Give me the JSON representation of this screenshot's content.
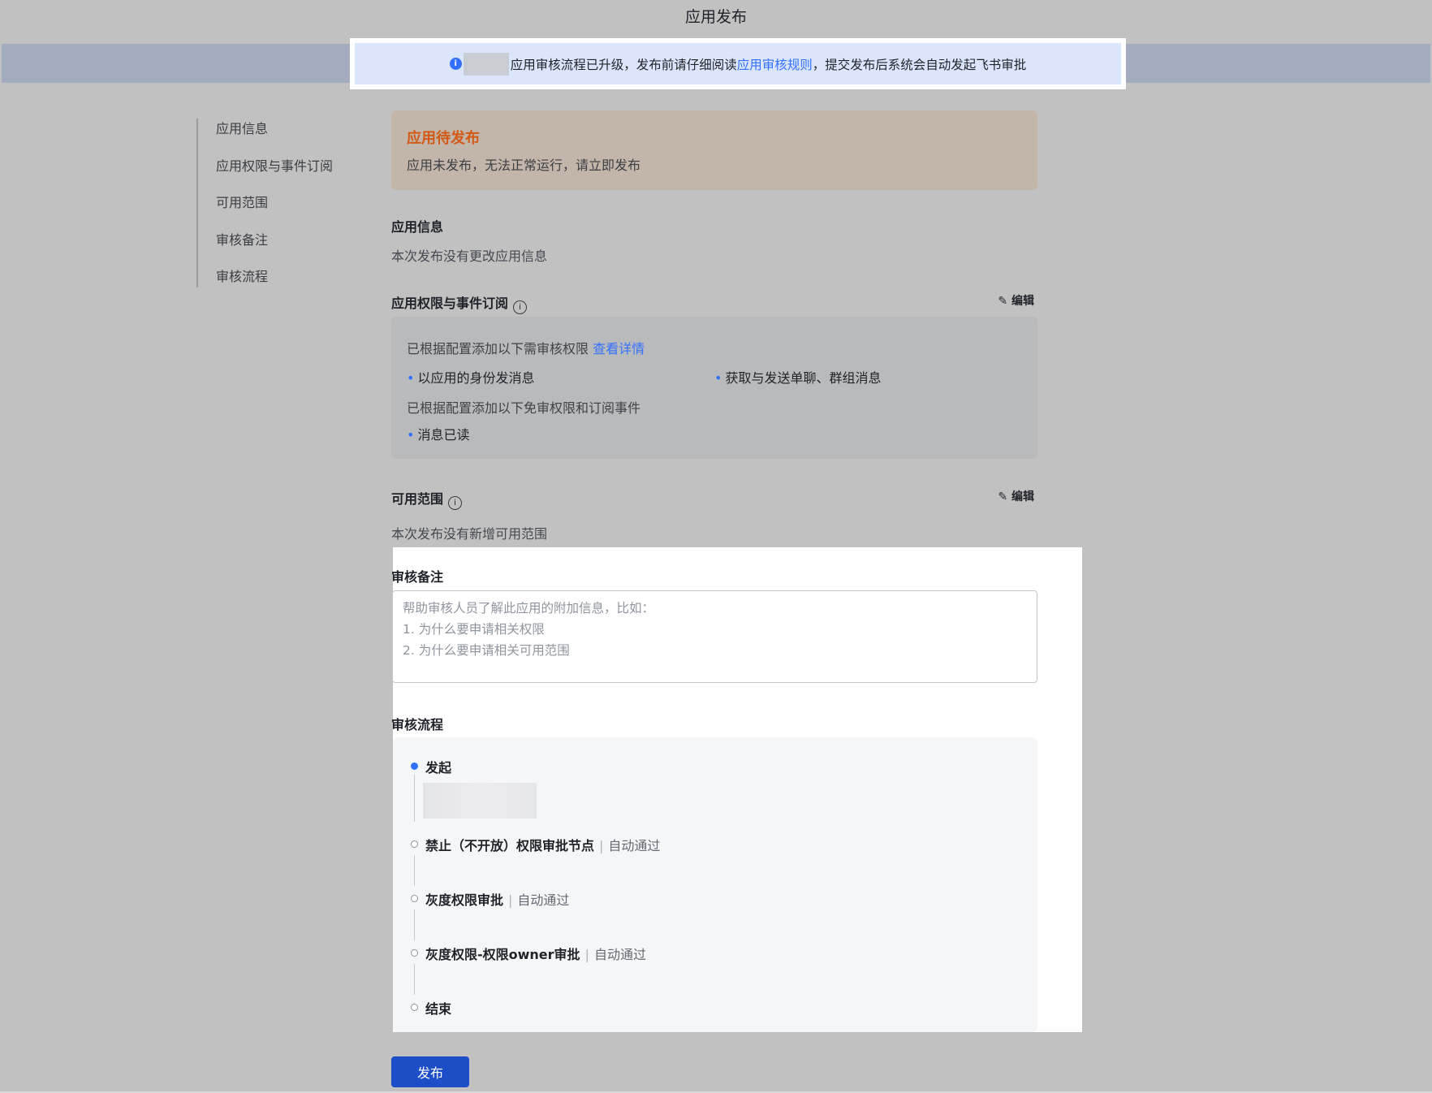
{
  "header": {
    "title": "应用发布"
  },
  "notice": {
    "text_before": "应用审核流程已升级，发布前请仔细阅读",
    "link": "应用审核规则",
    "text_after": "，提交发布后系统会自动发起飞书审批"
  },
  "nav": {
    "items": [
      {
        "label": "应用信息"
      },
      {
        "label": "应用权限与事件订阅"
      },
      {
        "label": "可用范围"
      },
      {
        "label": "审核备注"
      },
      {
        "label": "审核流程"
      }
    ]
  },
  "alert": {
    "title": "应用待发布",
    "text": "应用未发布，无法正常运行，请立即发布"
  },
  "app_info": {
    "title": "应用信息",
    "desc": "本次发布没有更改应用信息"
  },
  "permissions": {
    "title": "应用权限与事件订阅",
    "edit_label": "编辑",
    "review_line": "已根据配置添加以下需审核权限",
    "review_link": "查看详情",
    "review_items": [
      "以应用的身份发消息",
      "获取与发送单聊、群组消息"
    ],
    "exempt_line": "已根据配置添加以下免审权限和订阅事件",
    "exempt_items": [
      "消息已读"
    ]
  },
  "scope": {
    "title": "可用范围",
    "edit_label": "编辑",
    "desc": "本次发布没有新增可用范围"
  },
  "remarks": {
    "title": "审核备注",
    "placeholder_lines": [
      "帮助审核人员了解此应用的附加信息，比如：",
      "1. 为什么要申请相关权限",
      "2. 为什么要申请相关可用范围"
    ]
  },
  "flow": {
    "title": "审核流程",
    "steps": [
      {
        "label": "发起",
        "status": ""
      },
      {
        "label": "禁止（不开放）权限审批节点",
        "status": "自动通过"
      },
      {
        "label": "灰度权限审批",
        "status": "自动通过"
      },
      {
        "label": "灰度权限-权限owner审批",
        "status": "自动通过"
      },
      {
        "label": "结束",
        "status": ""
      }
    ]
  },
  "actions": {
    "publish_label": "发布"
  },
  "colors": {
    "accent": "#3370ff",
    "alert_title": "#d25a16",
    "button": "#1d4ec7"
  }
}
